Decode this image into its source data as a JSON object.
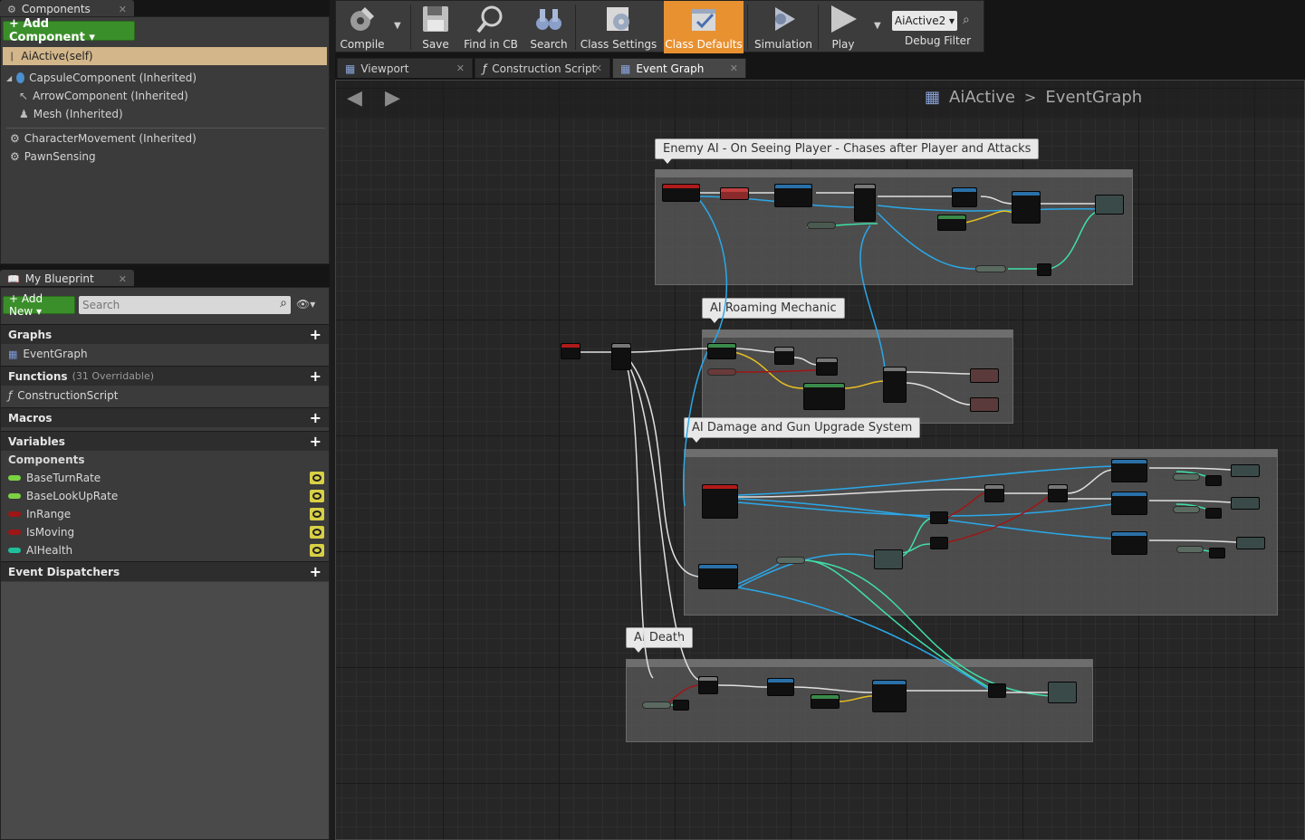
{
  "components_panel": {
    "tab_label": "Components",
    "add_button": "+ Add Component ▾",
    "self_row": "AiActive(self)",
    "items": [
      "CapsuleComponent (Inherited)",
      "ArrowComponent (Inherited)",
      "Mesh (Inherited)",
      "CharacterMovement (Inherited)",
      "PawnSensing"
    ]
  },
  "my_blueprint": {
    "tab_label": "My Blueprint",
    "add_new": "+ Add New ▾",
    "search_placeholder": "Search",
    "graphs_header": "Graphs",
    "graph_item": "EventGraph",
    "functions_header": "Functions",
    "functions_note": "(31 Overridable)",
    "function_item": "ConstructionScript",
    "macros_header": "Macros",
    "variables_header": "Variables",
    "variables_category": "Components",
    "variables": [
      {
        "name": "BaseTurnRate",
        "color": "#7ad341"
      },
      {
        "name": "BaseLookUpRate",
        "color": "#7ad341"
      },
      {
        "name": "InRange",
        "color": "#a01515"
      },
      {
        "name": "IsMoving",
        "color": "#a01515"
      },
      {
        "name": "AIHealth",
        "color": "#1fbf9a"
      }
    ],
    "event_dispatchers_header": "Event Dispatchers"
  },
  "toolbar": {
    "compile": "Compile",
    "save": "Save",
    "find_in_cb": "Find in CB",
    "search": "Search",
    "class_settings": "Class Settings",
    "class_defaults": "Class Defaults",
    "simulation": "Simulation",
    "play": "Play",
    "debug_object": "AiActive2 ▾",
    "debug_filter": "Debug Filter"
  },
  "doc_tabs": {
    "viewport": "Viewport",
    "construction_script": "Construction Script",
    "event_graph": "Event Graph"
  },
  "graph": {
    "breadcrumb_class": "AiActive",
    "breadcrumb_sep": ">",
    "breadcrumb_graph": "EventGraph",
    "comments": [
      "Enemy AI - On Seeing Player - Chases after Player and Attacks",
      "AI Roaming Mechanic",
      "AI Damage and Gun Upgrade System",
      "AI Death"
    ]
  },
  "colors": {
    "accent_active": "#e89131",
    "add_green": "#3b8f2a",
    "exec_wire": "#e0e0e0",
    "object_wire": "#2aa8e8",
    "float_wire": "#3fe0a8",
    "bool_wire": "#a01515",
    "string_wire": "#e8c020"
  }
}
